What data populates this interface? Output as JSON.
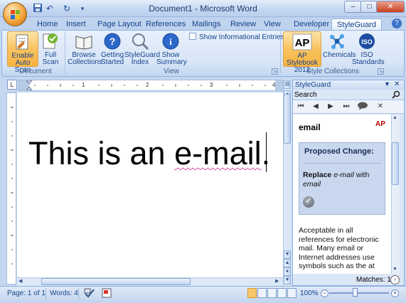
{
  "window": {
    "title": "Document1 - Microsoft Word",
    "buttons": {
      "minimize": "–",
      "maximize": "□",
      "close": "✕"
    }
  },
  "quick_access": {
    "save": "save-icon",
    "undo": "↶",
    "redo": "↻",
    "customize": "▾"
  },
  "tabs": [
    "Home",
    "Insert",
    "Page Layout",
    "References",
    "Mailings",
    "Review",
    "View",
    "Developer",
    "StyleGuard"
  ],
  "active_tab": "StyleGuard",
  "ribbon": {
    "groups": {
      "document": {
        "label": "Document",
        "buttons": [
          {
            "label1": "Enable",
            "label2": "Auto Scan"
          },
          {
            "label1": "Full",
            "label2": "Scan"
          }
        ]
      },
      "view": {
        "label": "View",
        "buttons": [
          {
            "label1": "Browse",
            "label2": "Collections"
          },
          {
            "label1": "Getting",
            "label2": "Started"
          },
          {
            "label1": "StyleGuard",
            "label2": "Index"
          },
          {
            "label1": "Show",
            "label2": "Summary"
          }
        ],
        "checkbox": "Show Informational Entries"
      },
      "collections": {
        "label": "Style Collections",
        "buttons": [
          {
            "label1": "AP Stylebook",
            "label2": "2012",
            "badge": "AP"
          },
          {
            "label1": "Chemicals",
            "label2": ""
          },
          {
            "label1": "ISO",
            "label2": "Standards",
            "badge": "ISO"
          }
        ]
      }
    }
  },
  "ruler": {
    "corner": "L",
    "numbers": [
      "1",
      "2",
      "3",
      "4"
    ]
  },
  "document": {
    "text_before": "This is an ",
    "flagged": "e-mail",
    "text_after": "."
  },
  "pane": {
    "title": "StyleGuard",
    "search_label": "Search",
    "entry_title": "email",
    "source_badge": "AP",
    "proposed_title": "Proposed Change:",
    "replace_bold": "Replace",
    "replace_from": "e-mail",
    "replace_with": "with",
    "replace_to": "email",
    "notes": "Acceptable in all references for electronic mail. Many email or Internet addresses use symbols such as the at",
    "matches": "Matches: 1"
  },
  "status": {
    "page": "Page: 1 of 1",
    "words": "Words: 4",
    "zoom": "100%"
  },
  "colors": {
    "accent": "#15428b",
    "highlight": "#f9c25e",
    "ribbon": "#d7e5f7"
  }
}
